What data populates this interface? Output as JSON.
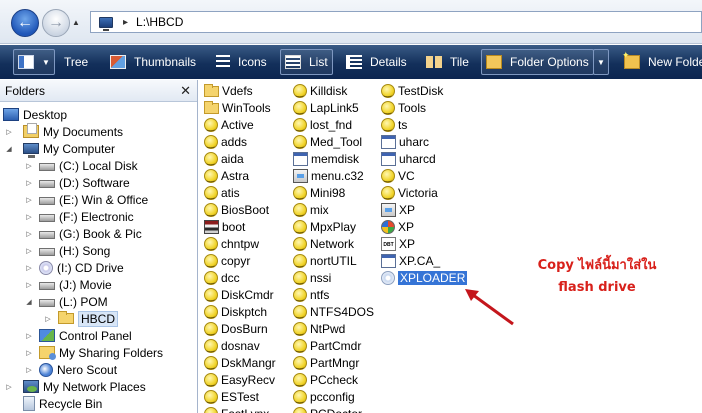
{
  "address": {
    "path": "L:\\HBCD"
  },
  "toolbar": {
    "tree": "Tree",
    "thumbnails": "Thumbnails",
    "icons": "Icons",
    "list": "List",
    "details": "Details",
    "tile": "Tile",
    "folder_options": "Folder Options",
    "new_folder": "New Folder"
  },
  "folders_pane": {
    "title": "Folders",
    "items": [
      {
        "label": "Desktop",
        "icon": "desktop-icon"
      },
      {
        "label": "My Documents",
        "icon": "documents-icon"
      },
      {
        "label": "My Computer",
        "icon": "computer-icon"
      },
      {
        "label": "(C:) Local Disk",
        "icon": "drive-icon"
      },
      {
        "label": "(D:) Software",
        "icon": "drive-icon"
      },
      {
        "label": "(E:) Win & Office",
        "icon": "drive-icon"
      },
      {
        "label": "(F:) Electronic",
        "icon": "drive-icon"
      },
      {
        "label": "(G:) Book & Pic",
        "icon": "drive-icon"
      },
      {
        "label": "(H:) Song",
        "icon": "drive-icon"
      },
      {
        "label": "(I:) CD Drive",
        "icon": "cd-drive-icon"
      },
      {
        "label": "(J:) Movie",
        "icon": "drive-icon"
      },
      {
        "label": "(L:) POM",
        "icon": "drive-icon"
      },
      {
        "label": "HBCD",
        "icon": "folder-icon"
      },
      {
        "label": "Control Panel",
        "icon": "control-panel-icon"
      },
      {
        "label": "My Sharing Folders",
        "icon": "sharing-folders-icon"
      },
      {
        "label": "Nero Scout",
        "icon": "nero-scout-icon"
      },
      {
        "label": "My Network Places",
        "icon": "network-places-icon"
      },
      {
        "label": "Recycle Bin",
        "icon": "recycle-bin-icon"
      }
    ]
  },
  "files": {
    "col1": [
      {
        "name": "Vdefs",
        "icon": "folder-icon"
      },
      {
        "name": "WinTools",
        "icon": "folder-icon"
      },
      {
        "name": "Active",
        "icon": "smiley-icon"
      },
      {
        "name": "adds",
        "icon": "smiley-icon"
      },
      {
        "name": "aida",
        "icon": "smiley-icon"
      },
      {
        "name": "Astra",
        "icon": "smiley-icon"
      },
      {
        "name": "atis",
        "icon": "smiley-icon"
      },
      {
        "name": "BiosBoot",
        "icon": "smiley-icon"
      },
      {
        "name": "boot",
        "icon": "archive-stack-icon"
      },
      {
        "name": "chntpw",
        "icon": "smiley-icon"
      },
      {
        "name": "copyr",
        "icon": "smiley-icon"
      },
      {
        "name": "dcc",
        "icon": "smiley-icon"
      },
      {
        "name": "DiskCmdr",
        "icon": "smiley-icon"
      },
      {
        "name": "Diskptch",
        "icon": "smiley-icon"
      },
      {
        "name": "DosBurn",
        "icon": "smiley-icon"
      },
      {
        "name": "dosnav",
        "icon": "smiley-icon"
      },
      {
        "name": "DskMangr",
        "icon": "smiley-icon"
      },
      {
        "name": "EasyRecv",
        "icon": "smiley-icon"
      },
      {
        "name": "ESTest",
        "icon": "smiley-icon"
      },
      {
        "name": "FastLynx",
        "icon": "smiley-icon"
      }
    ],
    "col2": [
      {
        "name": "Killdisk",
        "icon": "smiley-icon"
      },
      {
        "name": "LapLink5",
        "icon": "smiley-icon"
      },
      {
        "name": "lost_fnd",
        "icon": "smiley-icon"
      },
      {
        "name": "Med_Tool",
        "icon": "smiley-icon"
      },
      {
        "name": "memdisk",
        "icon": "app-file-icon"
      },
      {
        "name": "menu.c32",
        "icon": "system-file-icon"
      },
      {
        "name": "Mini98",
        "icon": "smiley-icon"
      },
      {
        "name": "mix",
        "icon": "smiley-icon"
      },
      {
        "name": "MpxPlay",
        "icon": "smiley-icon"
      },
      {
        "name": "Network",
        "icon": "smiley-icon"
      },
      {
        "name": "nortUTIL",
        "icon": "smiley-icon"
      },
      {
        "name": "nssi",
        "icon": "smiley-icon"
      },
      {
        "name": "ntfs",
        "icon": "smiley-icon"
      },
      {
        "name": "NTFS4DOS",
        "icon": "smiley-icon"
      },
      {
        "name": "NtPwd",
        "icon": "smiley-icon"
      },
      {
        "name": "PartCmdr",
        "icon": "smiley-icon"
      },
      {
        "name": "PartMngr",
        "icon": "smiley-icon"
      },
      {
        "name": "PCcheck",
        "icon": "smiley-icon"
      },
      {
        "name": "pcconfig",
        "icon": "smiley-icon"
      },
      {
        "name": "PCDoctor",
        "icon": "smiley-icon"
      }
    ],
    "col3": [
      {
        "name": "TestDisk",
        "icon": "smiley-icon"
      },
      {
        "name": "Tools",
        "icon": "smiley-icon"
      },
      {
        "name": "ts",
        "icon": "smiley-icon"
      },
      {
        "name": "uharc",
        "icon": "app-file-icon"
      },
      {
        "name": "uharcd",
        "icon": "app-file-icon"
      },
      {
        "name": "VC",
        "icon": "smiley-icon"
      },
      {
        "name": "Victoria",
        "icon": "smiley-icon"
      },
      {
        "name": "XP",
        "icon": "system-file-icon"
      },
      {
        "name": "XP",
        "icon": "xp-logo-icon"
      },
      {
        "name": "XP",
        "icon": "dbt-file-icon"
      },
      {
        "name": "XP.CA_",
        "icon": "app-file-icon"
      },
      {
        "name": "XPLOADER",
        "icon": "loader-file-icon",
        "selected": true
      }
    ]
  },
  "annotation": {
    "line1": "Copy ไฟล์นี้มาใส่ใน",
    "line2": "flash drive",
    "color": "#d8201a"
  },
  "colors": {
    "toolbar_bg": "#13305b",
    "selection": "#3574d6"
  }
}
